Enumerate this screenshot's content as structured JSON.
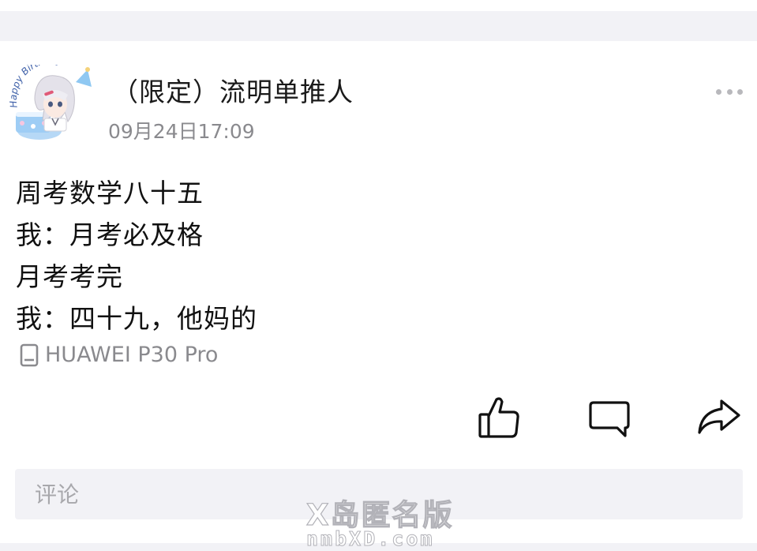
{
  "post": {
    "author_name": "（限定）流明单推人",
    "time": "09月24日17:09",
    "lines": [
      "周考数学八十五",
      "我：月考必及格",
      "月考考完",
      "我：四十九，他妈的"
    ],
    "device": "HUAWEI P30 Pro",
    "avatar_text": "Happy Birthday",
    "more_icon": "more-dots-icon",
    "device_icon": "phone-icon"
  },
  "actions": {
    "like_icon": "thumbs-up-icon",
    "comment_icon": "comment-bubble-icon",
    "share_icon": "share-arrow-icon"
  },
  "comment_box": {
    "placeholder": "评论",
    "value": ""
  },
  "watermark": {
    "title": "X岛匿名版",
    "site": "nmbXD.com"
  },
  "colors": {
    "page_background": "#f2f2f6",
    "card_background": "#ffffff",
    "secondary_text": "#8a8a8e",
    "primary_text": "#111111"
  }
}
